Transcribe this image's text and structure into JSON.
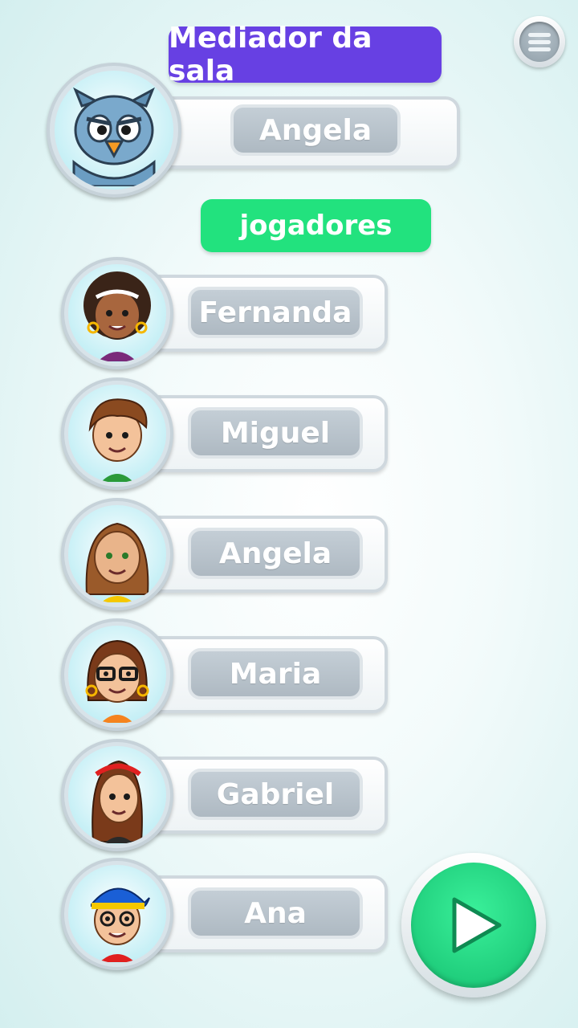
{
  "header": {
    "menu_icon": "hamburger-menu-icon",
    "mediator_label": "Mediador da sala",
    "mediator_name": "Angela",
    "mediator_avatar": "owl-avatar"
  },
  "players_label": "jogadores",
  "players": [
    {
      "name": "Fernanda",
      "avatar": "girl-curly-hair-avatar"
    },
    {
      "name": "Miguel",
      "avatar": "boy-brown-hair-avatar"
    },
    {
      "name": "Angela",
      "avatar": "woman-long-hair-avatar"
    },
    {
      "name": "Maria",
      "avatar": "woman-glasses-avatar"
    },
    {
      "name": "Gabriel",
      "avatar": "girl-headband-avatar"
    },
    {
      "name": "Ana",
      "avatar": "boy-cap-glasses-avatar"
    }
  ],
  "play_icon": "play-icon",
  "colors": {
    "mediator_pill": "#6740e3",
    "players_pill": "#22e27e",
    "play_button": "#1fd67f",
    "name_pill": "#b6c1ca"
  }
}
